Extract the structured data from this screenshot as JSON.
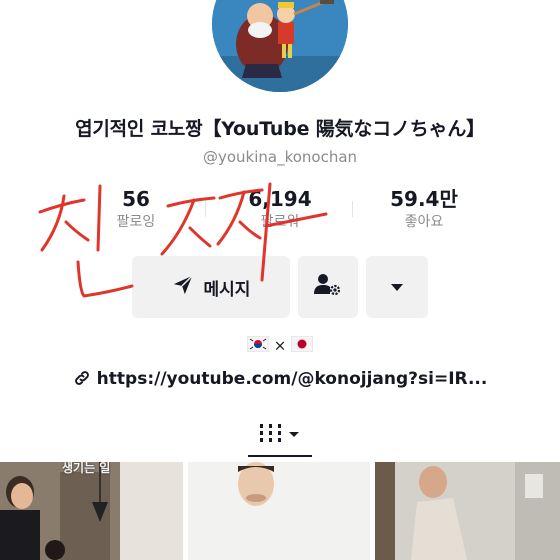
{
  "profile": {
    "display_name": "엽기적인 코노짱【YouTube 陽気なコノちゃん】",
    "handle": "@youkina_konochan"
  },
  "stats": [
    {
      "value": "56",
      "label": "팔로잉"
    },
    {
      "value": "6,194",
      "label": "팔로워"
    },
    {
      "value": "59.4만",
      "label": "좋아요"
    }
  ],
  "actions": {
    "message_label": "메시지"
  },
  "bio": {
    "separator": "×"
  },
  "link": {
    "url": "https://youtube.com/@konojjang?si=IR..."
  },
  "videos": [
    {
      "caption": "생기는 일"
    },
    {
      "caption": ""
    },
    {
      "caption": ""
    }
  ],
  "annotation": {
    "handwritten_text": "진짜"
  },
  "colors": {
    "text_primary": "#161823",
    "text_secondary": "#8a8b91",
    "button_bg": "#f1f1f2",
    "handwriting": "#e0352b"
  },
  "icons": {
    "message": "send-icon",
    "add_friend": "user-gear-icon",
    "more": "caret-down-icon",
    "link": "link-icon",
    "tab": "grid-icon"
  }
}
